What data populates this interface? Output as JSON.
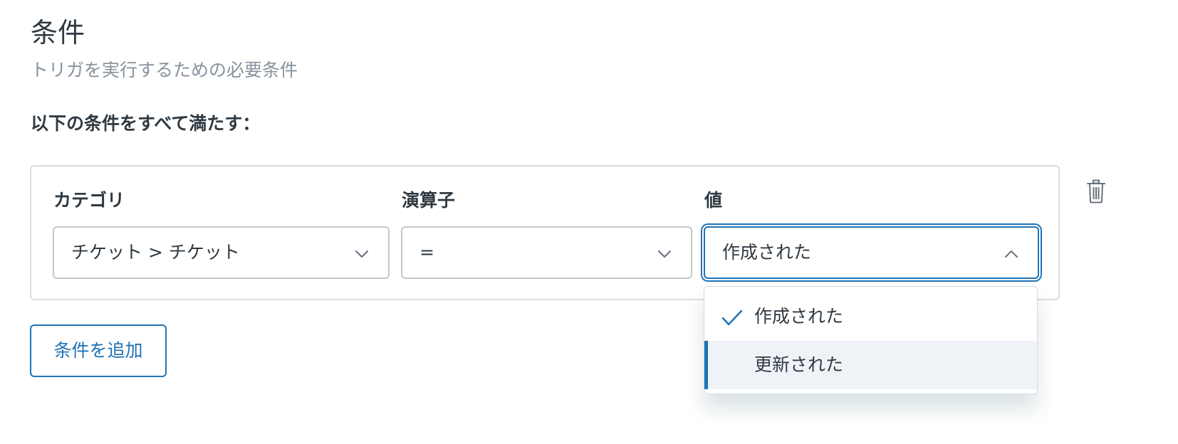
{
  "section": {
    "title": "条件",
    "subtitle": "トリガを実行するための必要条件",
    "match_label": "以下の条件をすべて満たす："
  },
  "condition": {
    "category_label": "カテゴリ",
    "category_value": "チケット > チケット",
    "operator_label": "演算子",
    "operator_value": "=",
    "value_label": "値",
    "value_value": "作成された"
  },
  "dropdown": {
    "options": [
      {
        "label": "作成された",
        "selected": true
      },
      {
        "label": "更新された",
        "selected": false
      }
    ]
  },
  "actions": {
    "add_condition_label": "条件を追加"
  },
  "icons": {
    "chevron": "chevron-down-icon",
    "chevron_open": "chevron-up-icon",
    "check": "check-icon",
    "trash": "trash-icon"
  },
  "colors": {
    "accent": "#1f73b7",
    "text": "#2f3941",
    "muted": "#87929d",
    "border": "#d8dcde",
    "hover": "#eff3f8"
  }
}
